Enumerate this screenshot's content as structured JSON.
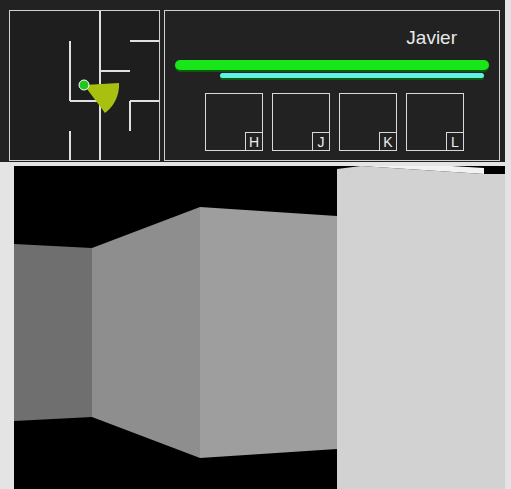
{
  "player": {
    "name": "Javier"
  },
  "bars": [
    {
      "name": "health",
      "level": 1,
      "color": "#19e619"
    },
    {
      "name": "energy",
      "level": 1,
      "color": "#5ff0e6"
    }
  ],
  "inventory": [
    {
      "key": "H",
      "empty": true
    },
    {
      "key": "J",
      "empty": true
    },
    {
      "key": "K",
      "empty": true
    },
    {
      "key": "L",
      "empty": true
    }
  ]
}
